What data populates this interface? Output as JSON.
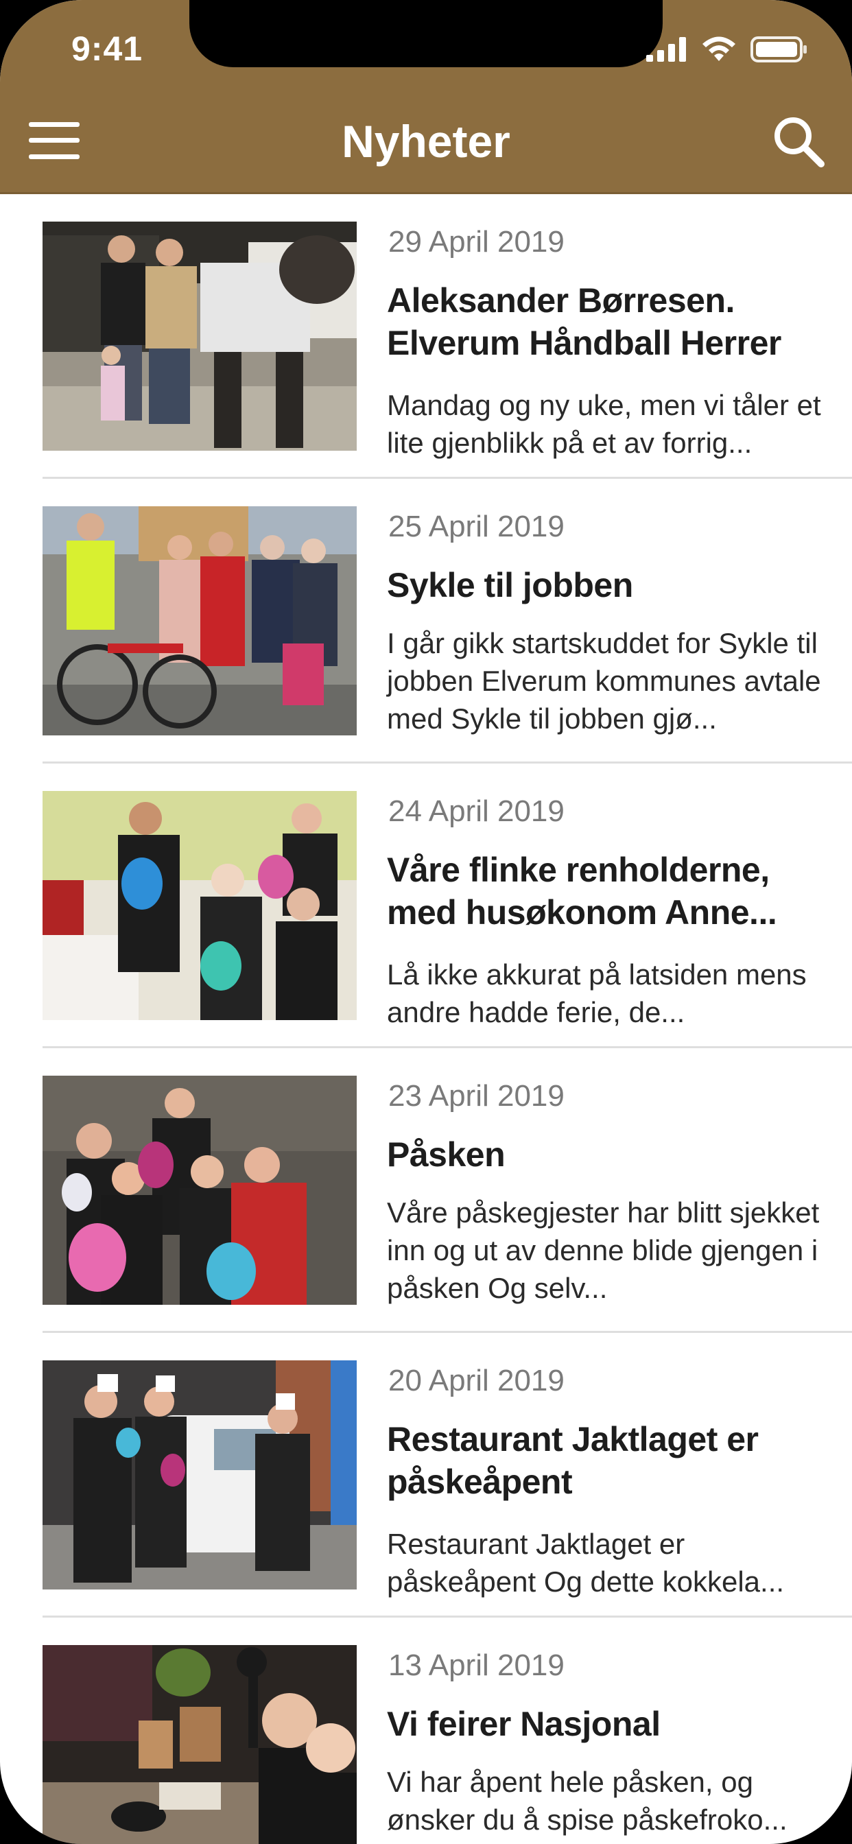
{
  "status_bar": {
    "time": "9:41"
  },
  "nav": {
    "title": "Nyheter",
    "menu_icon": "hamburger-menu-icon",
    "search_icon": "search-icon"
  },
  "colors": {
    "header_bg": "#8c6d3f",
    "text_primary": "#1d1d1d",
    "text_date": "#7a7a7a"
  },
  "news": [
    {
      "date": "29 April 2019",
      "title": "Aleksander Børresen. Elverum Håndball Herrer",
      "excerpt": "Mandag og ny uke, men vi tåler et lite gjenblikk på et av forrig..."
    },
    {
      "date": "25 April 2019",
      "title": "Sykle til jobben",
      "excerpt": "I går gikk startskuddet for Sykle til jobben Elverum kommunes avtale med Sykle til jobben gjø..."
    },
    {
      "date": "24 April 2019",
      "title": "Våre flinke renholderne, med husøkonom Anne...",
      "excerpt": "Lå ikke akkurat på latsiden mens andre hadde ferie, de..."
    },
    {
      "date": "23 April 2019",
      "title": "Påsken",
      "excerpt": "Våre påskegjester har blitt sjekket inn og ut av denne blide gjengen i påsken Og selv..."
    },
    {
      "date": "20 April 2019",
      "title": "Restaurant Jaktlaget er påskeåpent",
      "excerpt": "Restaurant Jaktlaget er påskeåpent Og dette kokkela..."
    },
    {
      "date": "13 April 2019",
      "title": "Vi feirer Nasjonal",
      "excerpt": "Vi har åpent hele påsken, og ønsker du å spise påskefroko..."
    }
  ]
}
